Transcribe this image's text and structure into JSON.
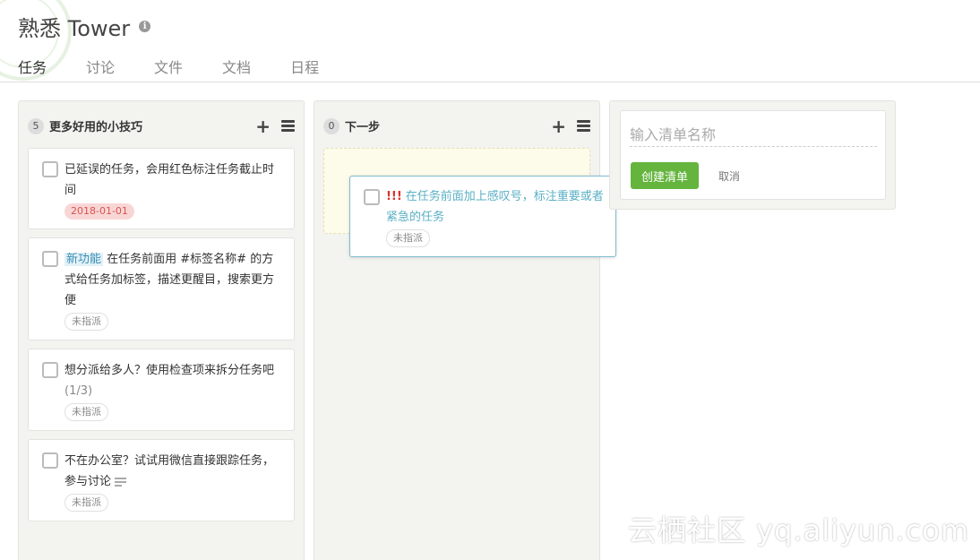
{
  "project": {
    "title": "熟悉 Tower",
    "info_icon": "i"
  },
  "tabs": [
    {
      "label": "任务"
    },
    {
      "label": "讨论"
    },
    {
      "label": "文件"
    },
    {
      "label": "文档"
    },
    {
      "label": "日程"
    }
  ],
  "lists": [
    {
      "count": "5",
      "title": "更多好用的小技巧",
      "add_icon": "+",
      "cards": [
        {
          "text": "已延误的任务，会用红色标注任务截止时间",
          "badge": "2018-01-01"
        },
        {
          "tag": "新功能",
          "text": " 在任务前面用 #标签名称# 的方式给任务加标签，描述更醒目，搜索更方便",
          "badge": "未指派"
        },
        {
          "text": "想分派给多人？使用检查项来拆分任务吧 ",
          "progress": "(1/3)",
          "badge": "未指派"
        },
        {
          "text": "不在办公室？试试用微信直接跟踪任务，参与讨论",
          "badge": "未指派"
        }
      ]
    },
    {
      "count": "0",
      "title": "下一步",
      "add_icon": "+"
    }
  ],
  "dragging_card": {
    "bang": "!!!",
    "text": "在任务前面加上感叹号，标注重要或者紧急的任务",
    "badge": "未指派"
  },
  "new_list": {
    "placeholder": "输入清单名称",
    "create_label": "创建清单",
    "cancel_label": "取消"
  },
  "watermark": "云栖社区 yq.aliyun.com"
}
